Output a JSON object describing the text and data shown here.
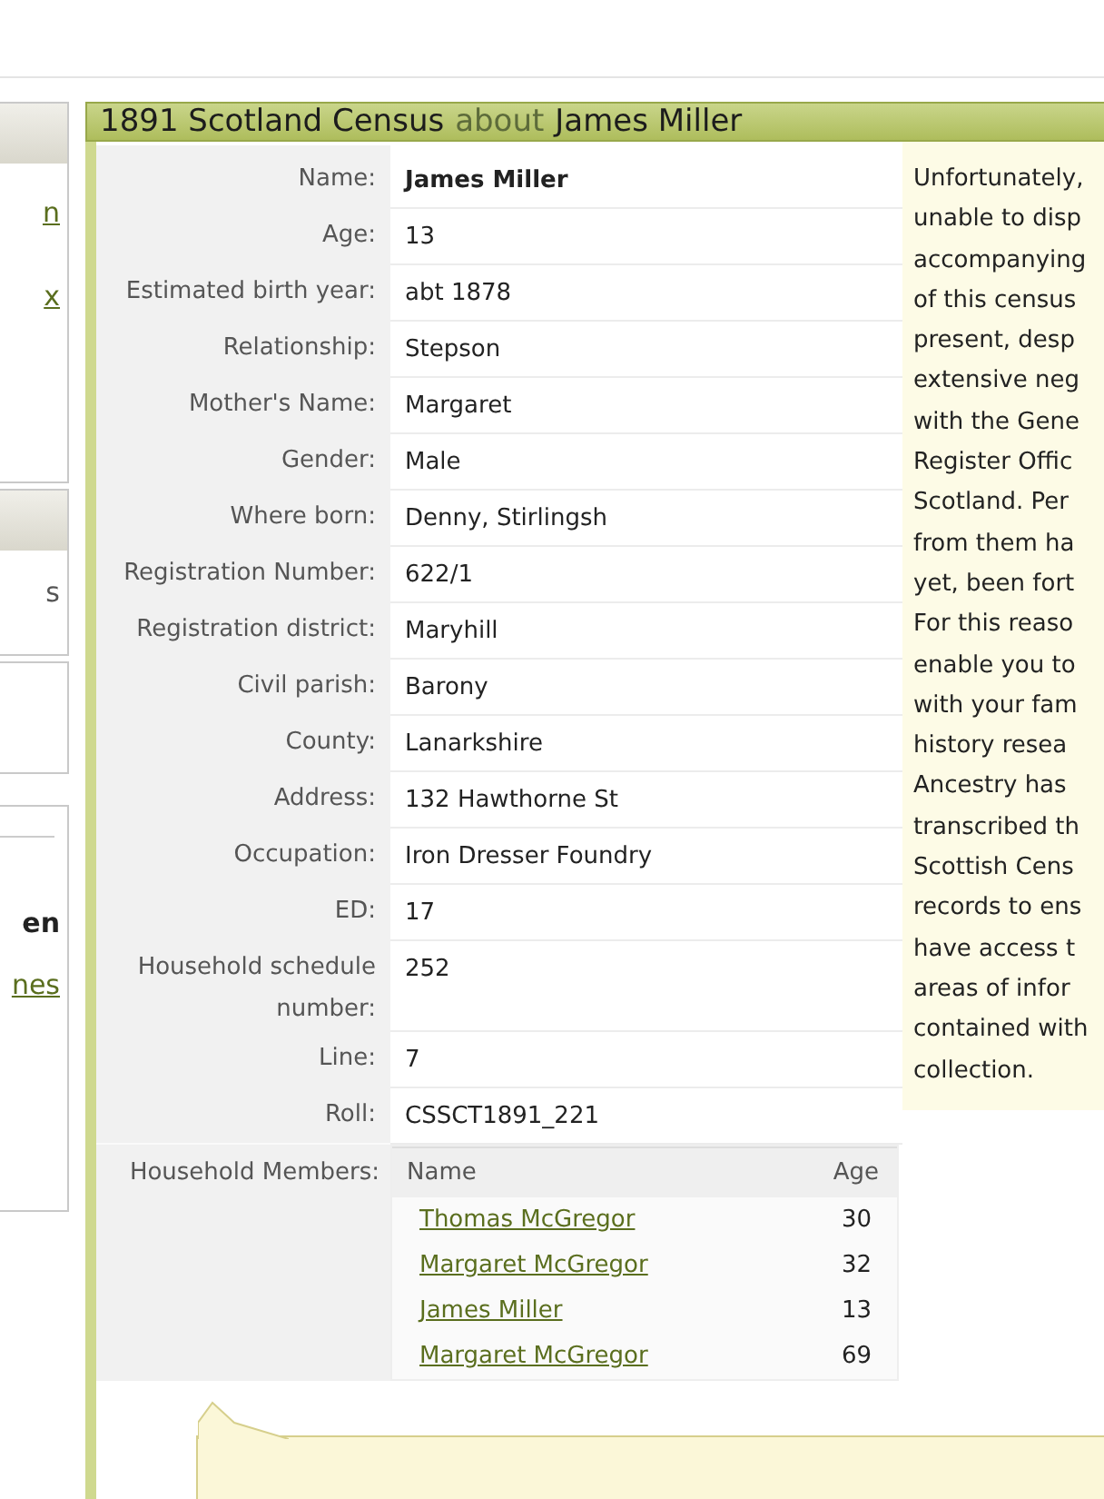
{
  "sidebar": {
    "boxes": [
      {
        "kind": "headed",
        "items": [
          {
            "kind": "link",
            "text": "n"
          },
          {
            "kind": "link",
            "text": "x"
          }
        ]
      },
      {
        "kind": "headed",
        "items": [
          {
            "kind": "text",
            "text": "s"
          }
        ]
      },
      {
        "kind": "plain"
      },
      {
        "kind": "divided",
        "items": [
          {
            "kind": "bold",
            "text": "en"
          },
          {
            "kind": "link",
            "text": "nes"
          }
        ]
      }
    ]
  },
  "record": {
    "title": "1891 Scotland Census",
    "connector": "about",
    "subject": "James Miller",
    "fields": [
      {
        "label": "Name:",
        "value": "James Miller",
        "bold": true
      },
      {
        "label": "Age:",
        "value": "13",
        "bold": false
      },
      {
        "label": "Estimated birth year:",
        "value": "abt 1878",
        "bold": false
      },
      {
        "label": "Relationship:",
        "value": "Stepson",
        "bold": false
      },
      {
        "label": "Mother's Name:",
        "value": "Margaret",
        "bold": false
      },
      {
        "label": "Gender:",
        "value": "Male",
        "bold": false
      },
      {
        "label": "Where born:",
        "value": "Denny, Stirlingsh",
        "bold": false
      },
      {
        "label": "Registration Number:",
        "value": "622/1",
        "bold": false
      },
      {
        "label": "Registration district:",
        "value": "Maryhill",
        "bold": false
      },
      {
        "label": "Civil parish:",
        "value": "Barony",
        "bold": false
      },
      {
        "label": "County:",
        "value": "Lanarkshire",
        "bold": false
      },
      {
        "label": "Address:",
        "value": "132 Hawthorne St",
        "bold": false
      },
      {
        "label": "Occupation:",
        "value": "Iron Dresser Foundry",
        "bold": false
      },
      {
        "label": "ED:",
        "value": "17",
        "bold": false
      },
      {
        "label": "Household schedule number:",
        "value": "252",
        "bold": false
      },
      {
        "label": "Line:",
        "value": "7",
        "bold": false
      },
      {
        "label": "Roll:",
        "value": "CSSCT1891_221",
        "bold": false
      }
    ],
    "household": {
      "label": "Household Members:",
      "columns": [
        "Name",
        "Age"
      ],
      "members": [
        {
          "name": "Thomas McGregor",
          "age": "30"
        },
        {
          "name": "Margaret McGregor",
          "age": "32"
        },
        {
          "name": "James Miller",
          "age": "13"
        },
        {
          "name": "Margaret McGregor",
          "age": "69"
        }
      ]
    },
    "note_lines": [
      "Unfortunately,",
      "unable to disp",
      "accompanying",
      "of this census",
      "present, desp",
      "extensive neg",
      "with the Gene",
      "Register Offic",
      "Scotland. Per",
      "from them ha",
      "yet, been fort",
      "For this reaso",
      "enable you to",
      "with your fam",
      "history resea",
      "Ancestry has",
      "transcribed th",
      "Scottish Cens",
      "records to ens",
      "have access t",
      "areas of infor",
      "contained with",
      "collection."
    ]
  }
}
